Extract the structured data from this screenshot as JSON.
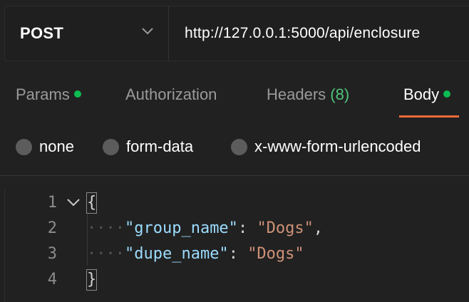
{
  "request": {
    "method": "POST",
    "url": "http://127.0.0.1:5000/api/enclosure"
  },
  "tabs": [
    {
      "label": "Params",
      "dot": true,
      "count": ""
    },
    {
      "label": "Authorization",
      "dot": false,
      "count": ""
    },
    {
      "label": "Headers",
      "dot": false,
      "count": "(8)"
    },
    {
      "label": "Body",
      "dot": true,
      "count": "",
      "active": true
    }
  ],
  "body_types": [
    {
      "label": "none"
    },
    {
      "label": "form-data"
    },
    {
      "label": "x-www-form-urlencoded"
    }
  ],
  "editor": {
    "line_numbers": [
      "1",
      "2",
      "3",
      "4"
    ],
    "open_brace": "{",
    "close_brace": "}",
    "indent": "····",
    "fields": [
      {
        "key": "\"group_name\"",
        "colon": ": ",
        "value": "\"Dogs\"",
        "trailing": ","
      },
      {
        "key": "\"dupe_name\"",
        "colon": ": ",
        "value": "\"Dogs\"",
        "trailing": ""
      }
    ]
  },
  "colors": {
    "accent": "#f26b3a",
    "status_dot": "#0cbb52",
    "json_key": "#9cdcfe",
    "json_string": "#ce9178"
  }
}
